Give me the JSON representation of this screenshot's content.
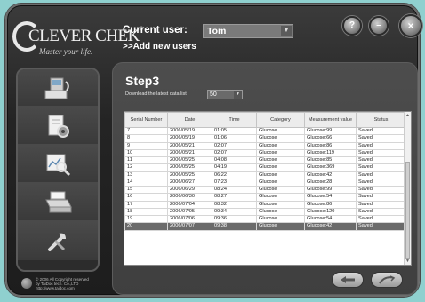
{
  "logo": {
    "brand": "CLEVER CHEK",
    "tagline": "Master your life."
  },
  "header": {
    "current_user_label": "Current user:",
    "current_user_value": "Tom",
    "add_user_link": ">>Add new users"
  },
  "window_buttons": {
    "help": "?",
    "minimize": "–",
    "close": "×"
  },
  "sidebar": {
    "items": [
      {
        "icon": "meter-transfer-icon"
      },
      {
        "icon": "settings-document-icon"
      },
      {
        "icon": "data-search-icon"
      },
      {
        "icon": "printer-icon"
      },
      {
        "icon": "tools-icon"
      }
    ]
  },
  "main": {
    "step_title": "Step3",
    "download_label": "Download the latest data list",
    "download_value": "50",
    "columns": [
      "Serial Number",
      "Date",
      "Time",
      "Category",
      "Measurement value",
      "Status"
    ],
    "rows": [
      [
        "7",
        "2006/05/19",
        "01:05",
        "Glucose",
        "Glucose:99",
        "Saved"
      ],
      [
        "8",
        "2006/05/19",
        "01:06",
        "Glucose",
        "Glucose:66",
        "Saved"
      ],
      [
        "9",
        "2006/05/21",
        "02:07",
        "Glucose",
        "Glucose:86",
        "Saved"
      ],
      [
        "10",
        "2006/05/21",
        "02:07",
        "Glucose",
        "Glucose:119",
        "Saved"
      ],
      [
        "11",
        "2006/05/25",
        "04:08",
        "Glucose",
        "Glucose:85",
        "Saved"
      ],
      [
        "12",
        "2006/05/25",
        "04:19",
        "Glucose",
        "Glucose:369",
        "Saved"
      ],
      [
        "13",
        "2006/05/25",
        "06:22",
        "Glucose",
        "Glucose:42",
        "Saved"
      ],
      [
        "14",
        "2006/06/27",
        "07:23",
        "Glucose",
        "Glucose:28",
        "Saved"
      ],
      [
        "15",
        "2006/06/29",
        "08:24",
        "Glucose",
        "Glucose:99",
        "Saved"
      ],
      [
        "16",
        "2006/06/30",
        "08:27",
        "Glucose",
        "Glucose:54",
        "Saved"
      ],
      [
        "17",
        "2006/07/04",
        "08:32",
        "Glucose",
        "Glucose:86",
        "Saved"
      ],
      [
        "18",
        "2006/07/05",
        "09:34",
        "Glucose",
        "Glucose:120",
        "Saved"
      ],
      [
        "19",
        "2006/07/06",
        "09:36",
        "Glucose",
        "Glucose:54",
        "Saved"
      ],
      [
        "20",
        "2006/07/07",
        "09:38",
        "Glucose",
        "Glucose:42",
        "Saved"
      ]
    ],
    "selected_row_index": 13
  },
  "footer": {
    "copyright_line1": "© 2006 All Copyright reserved",
    "copyright_line2": "by TaiDoc tech. Co.,LTD",
    "copyright_line3": "http://www.taidoc.com"
  }
}
